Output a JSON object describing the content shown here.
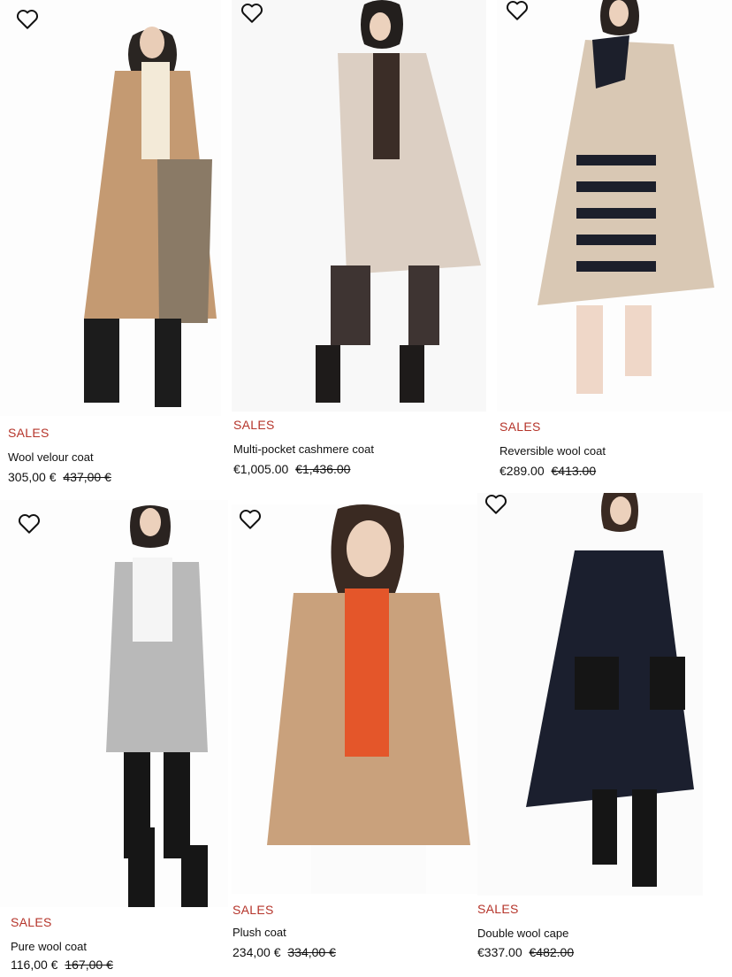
{
  "products": [
    {
      "badge": "SALES",
      "name": "Wool velour coat",
      "price": "305,00 €",
      "old_price": "437,00 €",
      "wishlist_icon": "heart-outline-icon"
    },
    {
      "badge": "SALES",
      "name": "Multi-pocket cashmere coat",
      "price": "€1,005.00",
      "old_price": "€1,436.00",
      "wishlist_icon": "heart-outline-icon"
    },
    {
      "badge": "SALES",
      "name": "Reversible wool coat",
      "price": "€289.00",
      "old_price": "€413.00",
      "wishlist_icon": "heart-outline-icon"
    },
    {
      "badge": "SALES",
      "name": "Pure wool coat",
      "price": "116,00 €",
      "old_price": "167,00 €",
      "wishlist_icon": "heart-outline-icon"
    },
    {
      "badge": "SALES",
      "name": "Plush coat",
      "price": "234,00 €",
      "old_price": "334,00 €",
      "wishlist_icon": "heart-outline-icon"
    },
    {
      "badge": "SALES",
      "name": "Double wool cape",
      "price": "€337.00",
      "old_price": "€482.00",
      "wishlist_icon": "heart-outline-icon"
    }
  ],
  "colors": {
    "sales_badge": "#b5342a",
    "coat_camel": "#c49a72",
    "coat_beige": "#dccfc3",
    "coat_sand": "#d9c8b4",
    "coat_grey": "#b9b9b9",
    "coat_plush": "#c9a17c",
    "coat_navy": "#1b1f2e"
  }
}
